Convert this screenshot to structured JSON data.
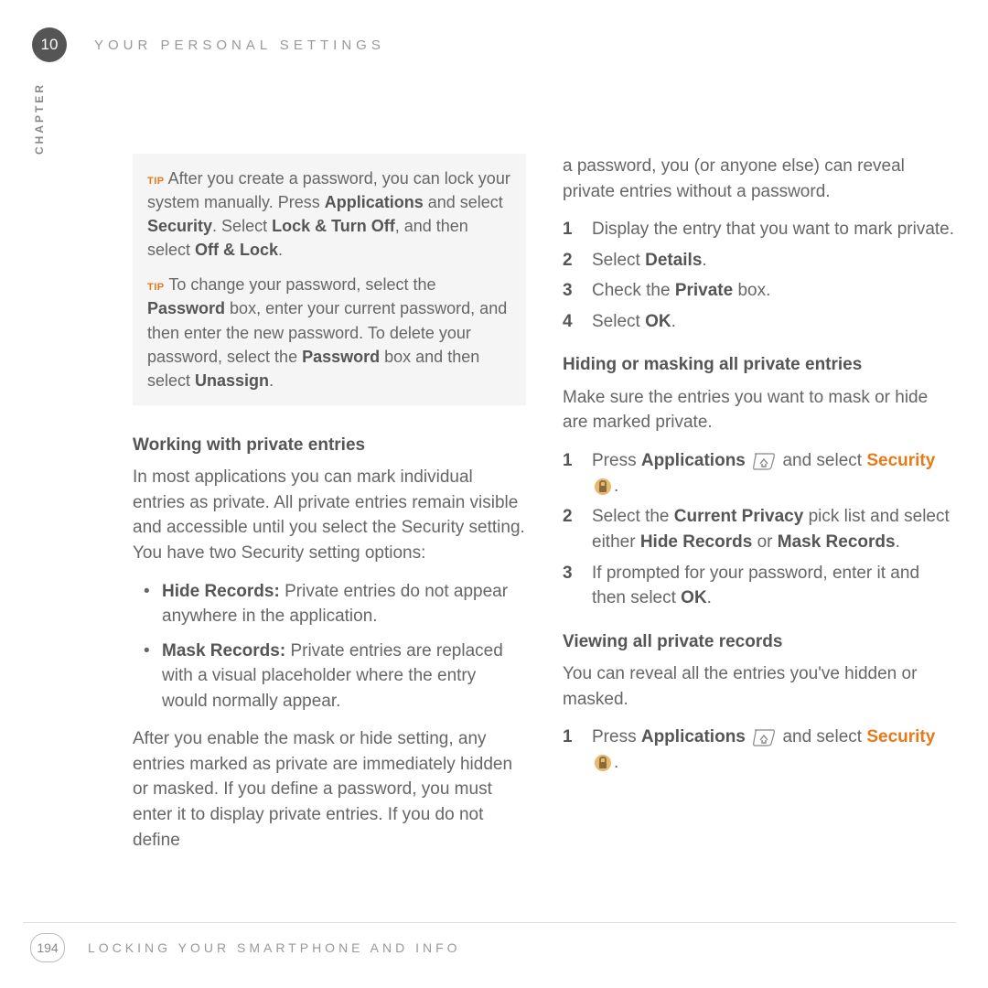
{
  "chapter_number": "10",
  "chapter_label": "CHAPTER",
  "header_title": "YOUR PERSONAL SETTINGS",
  "tip_label": "TIP",
  "tip1_a": "After you create a password, you can lock your system manually. Press ",
  "tip1_b": "Applications",
  "tip1_c": " and select ",
  "tip1_d": "Security",
  "tip1_e": ". Select ",
  "tip1_f": "Lock & Turn Off",
  "tip1_g": ", and then select ",
  "tip1_h": "Off & Lock",
  "tip1_i": ".",
  "tip2_a": "To change your password, select the ",
  "tip2_b": "Password",
  "tip2_c": " box, enter your current password, and then enter the new password. To delete your password, select the ",
  "tip2_d": "Password",
  "tip2_e": " box and then select ",
  "tip2_f": "Unassign",
  "tip2_g": ".",
  "section1_heading": "Working with private entries",
  "section1_para": "In most applications you can mark individual entries as private. All private entries remain visible and accessible until you select the Security setting. You have two Security setting options:",
  "bullet1_a": "Hide Records:",
  "bullet1_b": " Private entries do not appear anywhere in the application.",
  "bullet2_a": "Mask Records:",
  "bullet2_b": " Private entries are replaced with a visual placeholder where the entry would normally appear.",
  "section1_para2": "After you enable the mask or hide setting, any entries marked as private are immediately hidden or masked. If you define a password, you must enter it to display private entries. If you do not define ",
  "col2_top": "a password, you (or anyone else) can reveal private entries without a password.",
  "step1_1": "Display the entry that you want to mark private.",
  "step1_2a": "Select ",
  "step1_2b": "Details",
  "step1_2c": ".",
  "step1_3a": "Check the ",
  "step1_3b": "Private",
  "step1_3c": " box.",
  "step1_4a": "Select ",
  "step1_4b": "OK",
  "step1_4c": ".",
  "section2_heading": "Hiding or masking all private entries",
  "section2_para": "Make sure the entries you want to mask or hide are marked private.",
  "step2_1a": "Press ",
  "step2_1b": "Applications",
  "step2_1c": " and select ",
  "step2_1d": "Security",
  "step2_1e": ".",
  "step2_2a": "Select the ",
  "step2_2b": "Current Privacy",
  "step2_2c": " pick list and select either ",
  "step2_2d": "Hide Records",
  "step2_2e": " or ",
  "step2_2f": "Mask Records",
  "step2_2g": ".",
  "step2_3a": "If prompted for your password, enter it and then select ",
  "step2_3b": "OK",
  "step2_3c": ".",
  "section3_heading": "Viewing all private records",
  "section3_para": "You can reveal all the entries you've hidden or masked.",
  "step3_1a": "Press ",
  "step3_1b": "Applications",
  "step3_1c": " and select ",
  "step3_1d": "Security",
  "step3_1e": ".",
  "page_number": "194",
  "footer_title": "LOCKING YOUR SMARTPHONE AND INFO",
  "n1": "1",
  "n2": "2",
  "n3": "3",
  "n4": "4"
}
